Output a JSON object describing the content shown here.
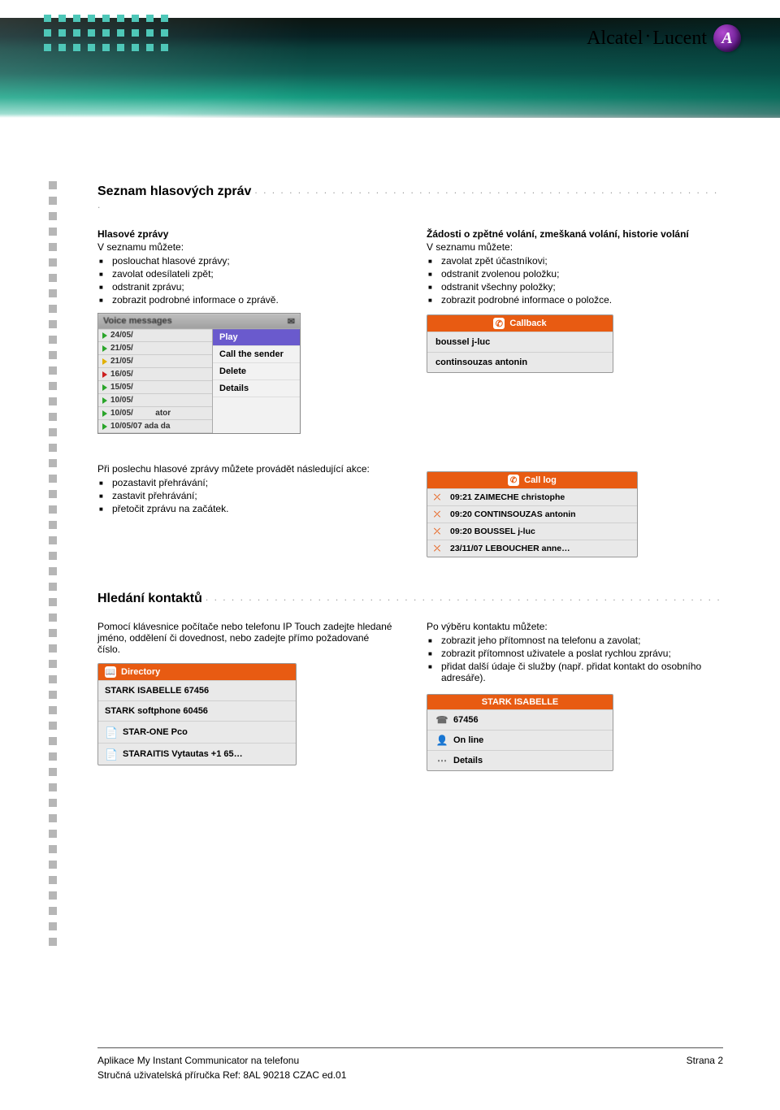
{
  "brand": {
    "name_a": "Alcatel",
    "name_b": "Lucent",
    "logo_glyph": "A"
  },
  "section1": {
    "title": "Seznam hlasových zpráv",
    "left": {
      "heading": "Hlasové zprávy",
      "lead": "V seznamu můžete:",
      "items": [
        "poslouchat hlasové zprávy;",
        "zavolat odesílateli zpět;",
        "odstranit zprávu;",
        "zobrazit podrobné informace o zprávě."
      ]
    },
    "right": {
      "heading": "Žádosti o zpětné volání, zmeškaná volání, historie volání",
      "lead": "V seznamu můžete:",
      "items": [
        "zavolat zpět účastníkovi;",
        "odstranit zvolenou položku;",
        "odstranit všechny položky;",
        "zobrazit podrobné informace o položce."
      ]
    }
  },
  "vm_widget": {
    "header": "Voice messages",
    "list": [
      "24/05/",
      "21/05/",
      "21/05/",
      "16/05/",
      "15/05/",
      "10/05/",
      "10/05/",
      "10/05/07 ada da"
    ],
    "list_extra": "ator",
    "menu": [
      "Play",
      "Call the sender",
      "Delete",
      "Details"
    ]
  },
  "callback_widget": {
    "title": "Callback",
    "rows": [
      "boussel j-luc",
      "continsouzas antonin"
    ]
  },
  "playback": {
    "lead": "Při poslechu hlasové zprávy můžete provádět následující akce:",
    "items": [
      "pozastavit přehrávání;",
      "zastavit přehrávání;",
      "přetočit zprávu na začátek."
    ]
  },
  "calllog_widget": {
    "title": "Call log",
    "rows": [
      "09:21 ZAIMECHE christophe",
      "09:20 CONTINSOUZAS antonin",
      "09:20 BOUSSEL j-luc",
      "23/11/07 LEBOUCHER anne…"
    ]
  },
  "section2": {
    "title": "Hledání kontaktů",
    "left_para": "Pomocí klávesnice počítače nebo telefonu IP Touch zadejte hledané jméno, oddělení či dovednost, nebo zadejte přímo požadované číslo.",
    "right_lead": "Po výběru kontaktu můžete:",
    "right_items": [
      "zobrazit jeho přítomnost na telefonu a zavolat;",
      "zobrazit přítomnost uživatele a poslat rychlou zprávu;",
      "přidat další údaje či služby (např. přidat kontakt do osobního adresáře)."
    ]
  },
  "directory_widget": {
    "title": "Directory",
    "rows": [
      "STARK ISABELLE 67456",
      "STARK softphone 60456",
      "STAR-ONE Pco",
      "STARAITIS Vytautas +1 65…"
    ]
  },
  "contact_widget": {
    "title": "STARK ISABELLE",
    "rows": [
      "67456",
      "On line",
      "Details"
    ]
  },
  "footer": {
    "left1": "Aplikace My Instant Communicator na telefonu",
    "right1": "Strana 2",
    "left2": "Stručná uživatelská příručka Ref: 8AL 90218 CZAC ed.01"
  }
}
